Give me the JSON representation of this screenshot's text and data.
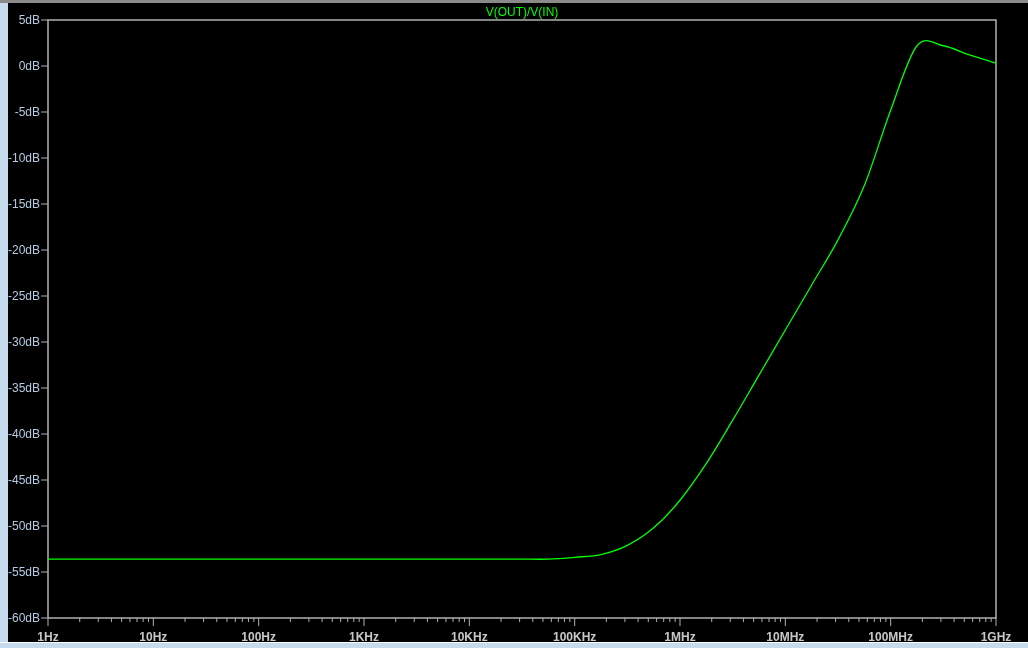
{
  "plot": {
    "chart_data": {
      "type": "line",
      "categories": [
        "1Hz",
        null,
        null,
        null,
        "10Hz",
        null,
        null,
        null,
        "100Hz",
        null,
        null,
        null,
        "1KHz",
        null,
        null,
        null,
        "10KHz",
        null,
        null,
        null,
        "100KHz",
        null,
        null,
        null,
        "1MHz",
        null,
        null,
        null,
        "10MHz",
        null,
        null,
        null,
        "100MHz",
        null,
        null,
        null,
        "1GHz"
      ],
      "series": [
        {
          "name": "V(OUT)/V(IN)",
          "color": "#00ff00",
          "values": [
            -53.6,
            -53.6,
            -53.6,
            -53.6,
            -53.6,
            -53.6,
            -53.6,
            -53.6,
            -53.6,
            -53.6,
            -53.6,
            -53.6,
            -53.6,
            -53.6,
            -53.6,
            -53.6,
            -53.6,
            -53.6,
            -53.6,
            -53.6,
            -53.4,
            -53.1,
            -52.1,
            -50.2,
            -47.2,
            -43.2,
            -38.5,
            -33.6,
            -28.7,
            -23.8,
            -18.9,
            -13.0,
            -4.8,
            2.2,
            2.2,
            1.2,
            0.3
          ]
        }
      ],
      "ylim": [
        -60,
        5
      ],
      "yticks": [
        {
          "value": 5,
          "label": "5dB"
        },
        {
          "value": 0,
          "label": "0dB"
        },
        {
          "value": -5,
          "label": "-5dB"
        },
        {
          "value": -10,
          "label": "-10dB"
        },
        {
          "value": -15,
          "label": "-15dB"
        },
        {
          "value": -20,
          "label": "-20dB"
        },
        {
          "value": -25,
          "label": "-25dB"
        },
        {
          "value": -30,
          "label": "-30dB"
        },
        {
          "value": -35,
          "label": "-35dB"
        },
        {
          "value": -40,
          "label": "-40dB"
        },
        {
          "value": -45,
          "label": "-45dB"
        },
        {
          "value": -50,
          "label": "-50dB"
        },
        {
          "value": -55,
          "label": "-55dB"
        },
        {
          "value": -60,
          "label": "-60dB"
        }
      ]
    }
  }
}
